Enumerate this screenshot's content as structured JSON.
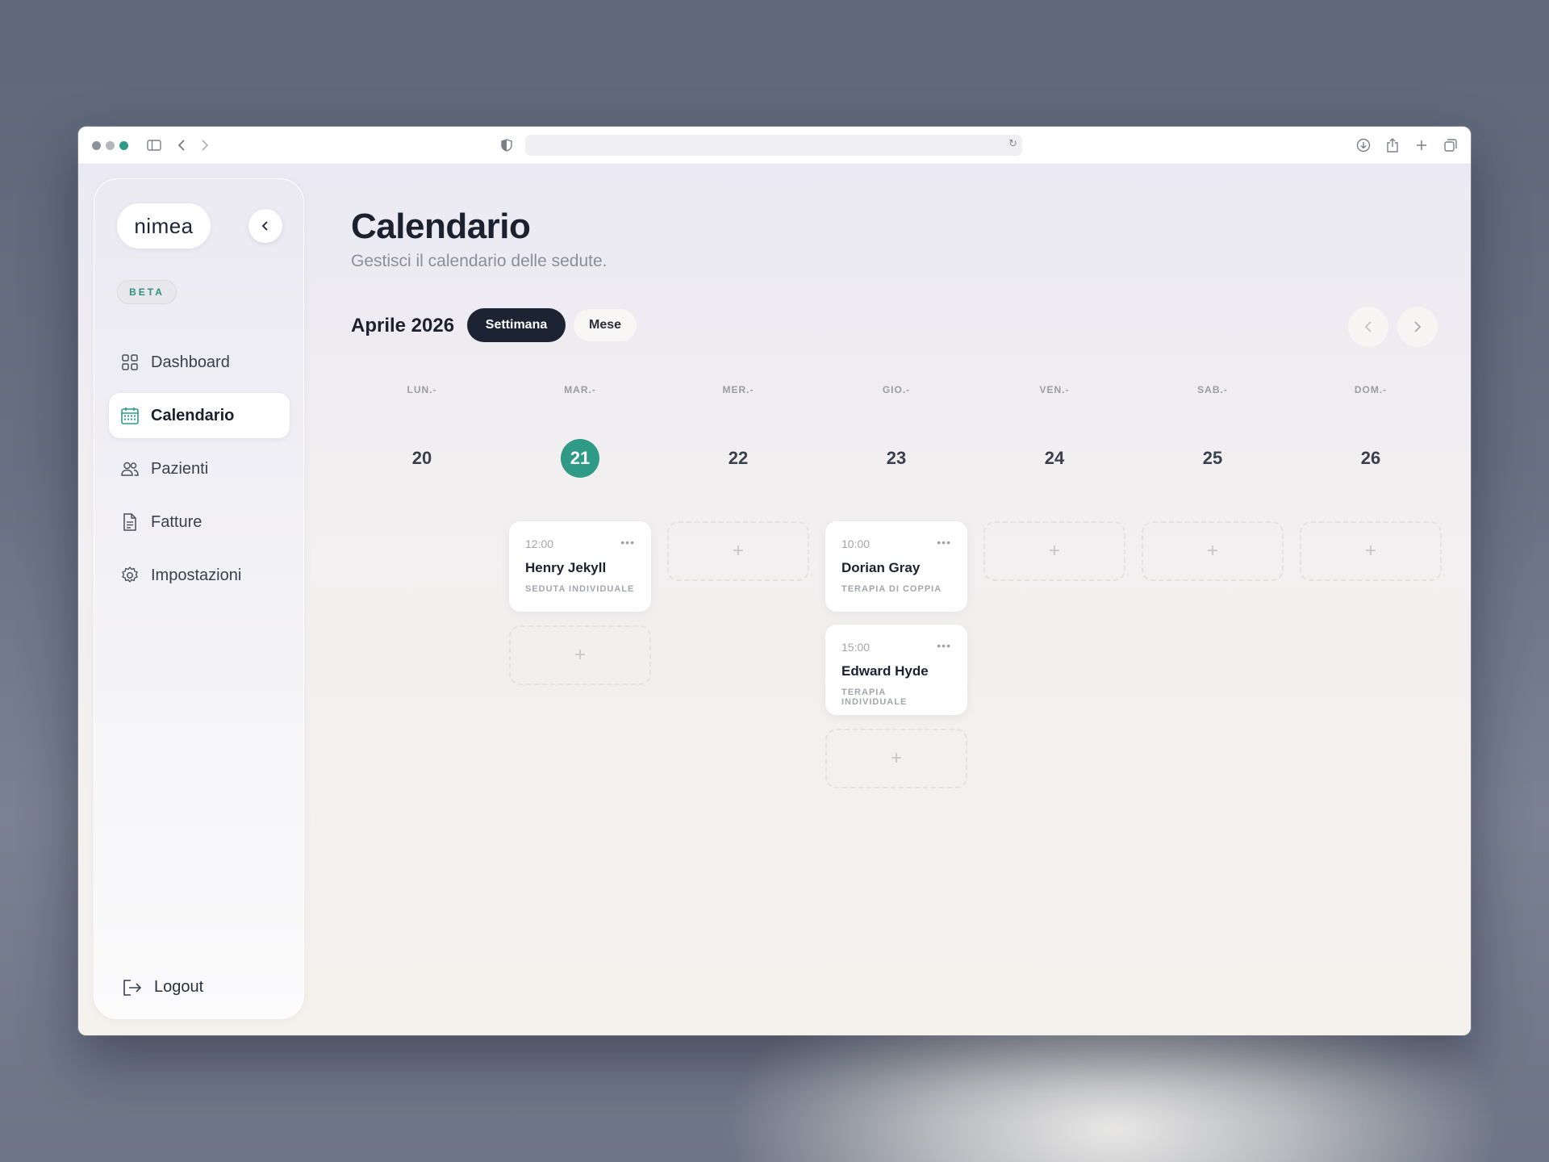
{
  "browser": {
    "traffic_colors": [
      "#8e9199",
      "#b4b6bb",
      "#2f9a86"
    ],
    "icons": [
      "sidebar-icon",
      "back-icon",
      "forward-icon",
      "privacy-shield-icon",
      "reload-icon",
      "download-icon",
      "share-icon",
      "new-tab-icon",
      "tabs-overview-icon"
    ]
  },
  "sidebar": {
    "logo": "nimea",
    "badge": "BETA",
    "items": [
      {
        "label": "Dashboard",
        "icon": "grid-icon",
        "active": false
      },
      {
        "label": "Calendario",
        "icon": "calendar-icon",
        "active": true
      },
      {
        "label": "Pazienti",
        "icon": "users-icon",
        "active": false
      },
      {
        "label": "Fatture",
        "icon": "document-icon",
        "active": false
      },
      {
        "label": "Impostazioni",
        "icon": "gear-icon",
        "active": false
      }
    ],
    "logout": "Logout"
  },
  "header": {
    "title": "Calendario",
    "subtitle": "Gestisci il calendario delle sedute."
  },
  "toolbar": {
    "month": "Aprile 2026",
    "view_week": "Settimana",
    "view_month": "Mese"
  },
  "colors": {
    "accent": "#2f9a86",
    "dark": "#1c2434"
  },
  "days": [
    {
      "dow": "LUN.-",
      "date": "20"
    },
    {
      "dow": "MAR.-",
      "date": "21",
      "today": true
    },
    {
      "dow": "MER.-",
      "date": "22"
    },
    {
      "dow": "GIO.-",
      "date": "23"
    },
    {
      "dow": "VEN.-",
      "date": "24"
    },
    {
      "dow": "SAB.-",
      "date": "25"
    },
    {
      "dow": "DOM.-",
      "date": "26"
    }
  ],
  "appointments": [
    {
      "time": "12:00",
      "name": "Henry Jekyll",
      "type": "SEDUTA INDIVIDUALE",
      "more": "•••"
    },
    {
      "time": "10:00",
      "name": "Dorian Gray",
      "type": "TERAPIA DI COPPIA",
      "more": "•••"
    },
    {
      "time": "15:00",
      "name": "Edward Hyde",
      "type": "TERAPIA INDIVIDUALE",
      "more": "•••"
    }
  ],
  "add_label": "+"
}
